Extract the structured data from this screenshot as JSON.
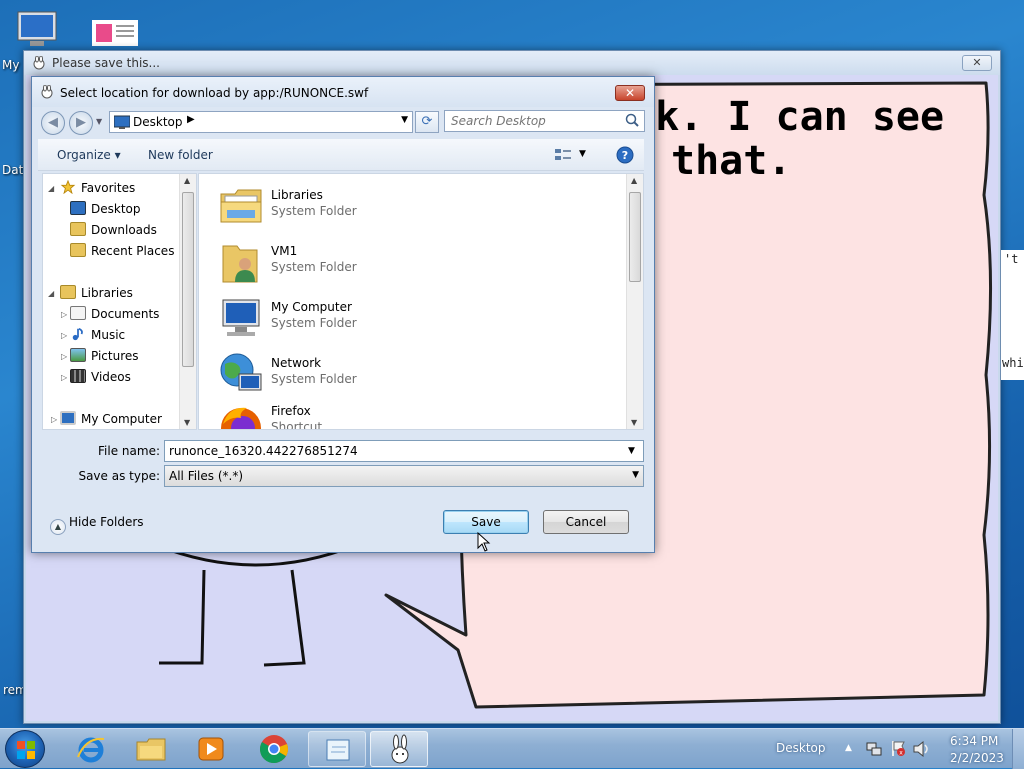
{
  "desktop": {
    "icon_labels": [
      "My",
      "Dat",
      "remi"
    ]
  },
  "flash_window": {
    "title": "Please save this...",
    "close_symbol": "✕",
    "speech_lines": [
      "ok. I can see",
      "that."
    ],
    "side_text": [
      "'t",
      "whi"
    ]
  },
  "dialog": {
    "title": "Select location for download by app:/RUNONCE.swf",
    "close_symbol": "✕",
    "address": "Desktop",
    "search_placeholder": "Search Desktop",
    "toolbar": {
      "organize": "Organize ▾",
      "new_folder": "New folder"
    },
    "nav": {
      "favorites": "Favorites",
      "desktop": "Desktop",
      "downloads": "Downloads",
      "recent_places": "Recent Places",
      "libraries": "Libraries",
      "documents": "Documents",
      "music": "Music",
      "pictures": "Pictures",
      "videos": "Videos",
      "my_computer": "My Computer"
    },
    "files": [
      {
        "name": "Libraries",
        "type": "System Folder",
        "icon": "libraries-icon"
      },
      {
        "name": "VM1",
        "type": "System Folder",
        "icon": "user-folder-icon"
      },
      {
        "name": "My Computer",
        "type": "System Folder",
        "icon": "computer-icon"
      },
      {
        "name": "Network",
        "type": "System Folder",
        "icon": "network-icon"
      },
      {
        "name": "Firefox",
        "type": "Shortcut",
        "icon": "firefox-icon"
      }
    ],
    "file_name_label": "File name:",
    "file_name_value": "runonce_16320.442276851274",
    "save_type_label": "Save as type:",
    "save_type_value": "All Files (*.*)",
    "hide_folders": "Hide Folders",
    "save_button": "Save",
    "cancel_button": "Cancel"
  },
  "taskbar": {
    "apps": [
      "internet-explorer",
      "file-explorer",
      "media-player",
      "chrome",
      "notepad",
      "flash-app"
    ],
    "toolbar_label": "Desktop",
    "time": "6:34 PM",
    "date": "2/2/2023"
  },
  "colors": {
    "desktop_bg": "#1d6fb8",
    "flash_bg": "#d6d8f6",
    "speech_bubble": "#fde3e3",
    "dialog_bg": "#dce6f3",
    "close_red": "#c7442c"
  }
}
